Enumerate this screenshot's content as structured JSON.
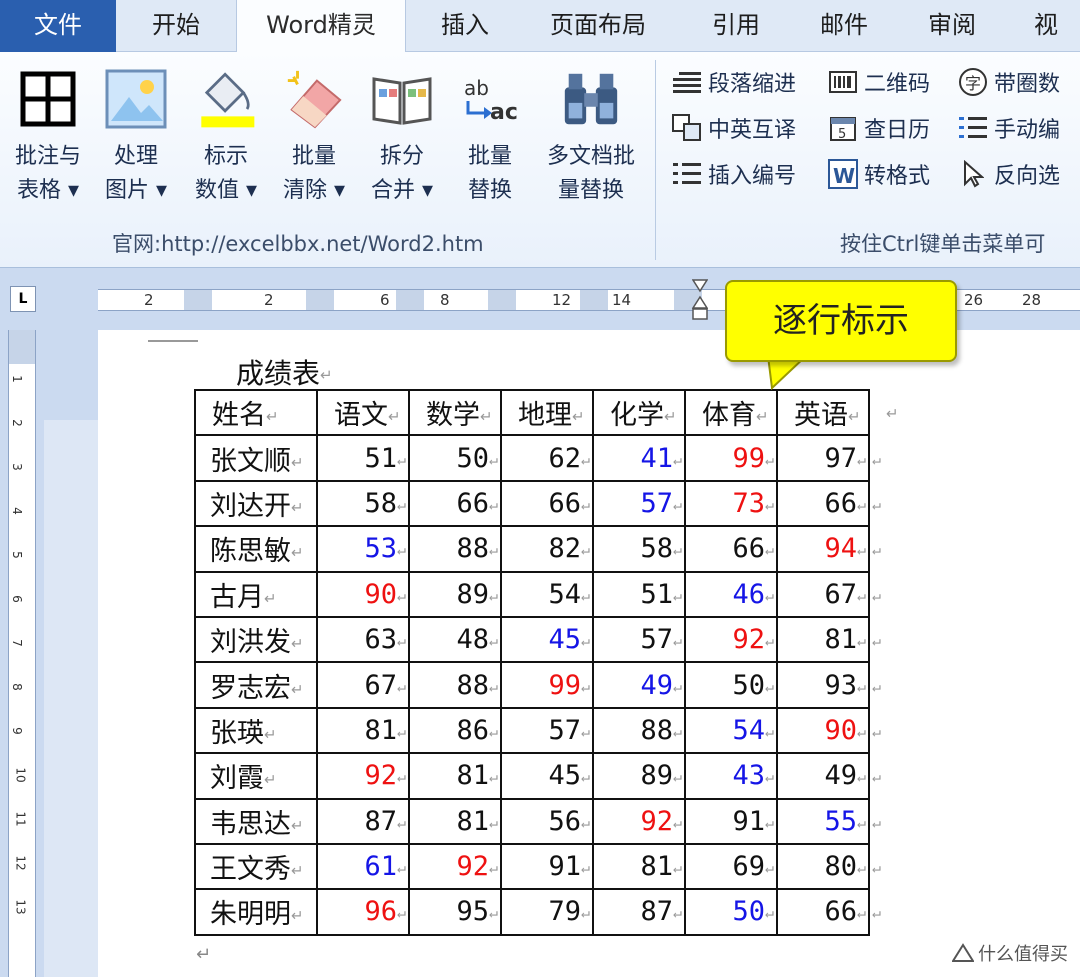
{
  "tabs": [
    "文件",
    "开始",
    "Word精灵",
    "插入",
    "页面布局",
    "引用",
    "邮件",
    "审阅",
    "视图"
  ],
  "ribbon": {
    "large_buttons": [
      {
        "line1": "批注与",
        "line2": "表格 ▾"
      },
      {
        "line1": "处理",
        "line2": "图片 ▾"
      },
      {
        "line1": "标示",
        "line2": "数值 ▾"
      },
      {
        "line1": "批量",
        "line2": "清除 ▾"
      },
      {
        "line1": "拆分",
        "line2": "合并 ▾"
      },
      {
        "line1": "批量",
        "line2": "替换"
      },
      {
        "line1": "多文档批",
        "line2": "量替换"
      }
    ],
    "small_commands": [
      "段落缩进",
      "二维码",
      "带圈数",
      "中英互译",
      "查日历",
      "手动编",
      "插入编号",
      "转格式",
      "反向选"
    ],
    "group_label_left": "官网:http://excelbbx.net/Word2.htm",
    "group_label_right": "按住Ctrl键单击菜单可"
  },
  "ruler": {
    "corner": "L",
    "numbers": [
      "2",
      "2",
      "6",
      "8",
      "12",
      "14",
      "26",
      "28"
    ],
    "vertical_numbers": [
      "1",
      "2",
      "3",
      "4",
      "5",
      "6",
      "7",
      "8",
      "9",
      "10",
      "11",
      "12",
      "13"
    ]
  },
  "document": {
    "title": "成绩表",
    "headers": [
      "姓名",
      "语文",
      "数学",
      "地理",
      "化学",
      "体育",
      "英语"
    ],
    "rows": [
      {
        "name": "张文顺",
        "scores": [
          51,
          50,
          62,
          41,
          99,
          97
        ],
        "marks": [
          "",
          "",
          "",
          "blue",
          "red",
          ""
        ]
      },
      {
        "name": "刘达开",
        "scores": [
          58,
          66,
          66,
          57,
          73,
          66
        ],
        "marks": [
          "",
          "",
          "",
          "blue",
          "red",
          ""
        ]
      },
      {
        "name": "陈思敏",
        "scores": [
          53,
          88,
          82,
          58,
          66,
          94
        ],
        "marks": [
          "blue",
          "",
          "",
          "",
          "",
          "red"
        ]
      },
      {
        "name": "古月",
        "scores": [
          90,
          89,
          54,
          51,
          46,
          67
        ],
        "marks": [
          "red",
          "",
          "",
          "",
          "blue",
          ""
        ]
      },
      {
        "name": "刘洪发",
        "scores": [
          63,
          48,
          45,
          57,
          92,
          81
        ],
        "marks": [
          "",
          "",
          "blue",
          "",
          "red",
          ""
        ]
      },
      {
        "name": "罗志宏",
        "scores": [
          67,
          88,
          99,
          49,
          50,
          93
        ],
        "marks": [
          "",
          "",
          "red",
          "blue",
          "",
          ""
        ]
      },
      {
        "name": "张瑛",
        "scores": [
          81,
          86,
          57,
          88,
          54,
          90
        ],
        "marks": [
          "",
          "",
          "",
          "",
          "blue",
          "red"
        ]
      },
      {
        "name": "刘霞",
        "scores": [
          92,
          81,
          45,
          89,
          43,
          49
        ],
        "marks": [
          "red",
          "",
          "",
          "",
          "blue",
          ""
        ]
      },
      {
        "name": "韦思达",
        "scores": [
          87,
          81,
          56,
          92,
          91,
          55
        ],
        "marks": [
          "",
          "",
          "",
          "red",
          "",
          "blue"
        ]
      },
      {
        "name": "王文秀",
        "scores": [
          61,
          92,
          91,
          81,
          69,
          80
        ],
        "marks": [
          "blue",
          "red",
          "",
          "",
          "",
          ""
        ]
      },
      {
        "name": "朱明明",
        "scores": [
          96,
          95,
          79,
          87,
          50,
          66
        ],
        "marks": [
          "red",
          "",
          "",
          "",
          "blue",
          ""
        ]
      }
    ],
    "paragraph_mark": "↵"
  },
  "callout": {
    "text": "逐行标示"
  },
  "colors": {
    "max": "#ee1111",
    "min": "#1515e6",
    "file_tab": "#2a5faf",
    "callout": "#ffff00"
  },
  "watermark": "什么值得买"
}
